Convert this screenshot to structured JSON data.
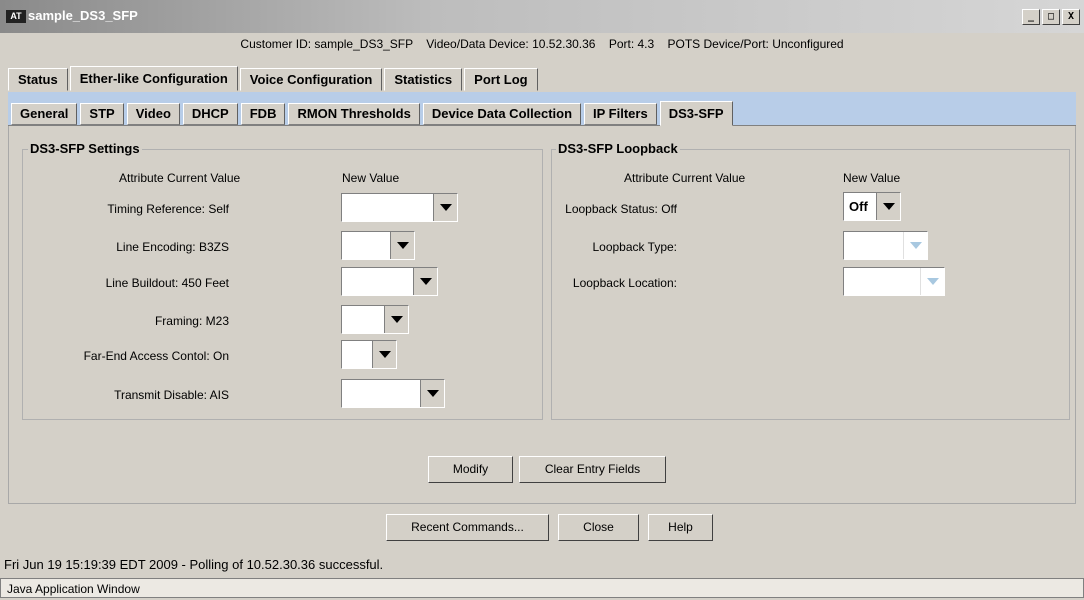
{
  "window": {
    "title": "sample_DS3_SFP",
    "app_icon": "app-logo-icon",
    "controls": {
      "minimize": "_",
      "maximize": "□",
      "close": "X"
    }
  },
  "info": {
    "text": "Customer ID: sample_DS3_SFP    Video/Data Device: 10.52.30.36    Port: 4.3    POTS Device/Port: Unconfigured"
  },
  "main_tabs": [
    {
      "label": "Status"
    },
    {
      "label": "Ether-like Configuration",
      "selected": true
    },
    {
      "label": "Voice Configuration"
    },
    {
      "label": "Statistics"
    },
    {
      "label": "Port Log"
    }
  ],
  "sub_tabs": [
    {
      "label": "General"
    },
    {
      "label": "STP"
    },
    {
      "label": "Video"
    },
    {
      "label": "DHCP"
    },
    {
      "label": "FDB"
    },
    {
      "label": "RMON Thresholds"
    },
    {
      "label": "Device Data Collection"
    },
    {
      "label": "IP Filters"
    },
    {
      "label": "DS3-SFP",
      "selected": true
    }
  ],
  "settings": {
    "title": "DS3-SFP Settings",
    "header_attr": "Attribute Current Value",
    "header_new": "New Value",
    "rows": [
      {
        "label": "Timing Reference: Self",
        "new_value": ""
      },
      {
        "label": "Line Encoding: B3ZS",
        "new_value": ""
      },
      {
        "label": "Line Buildout: 450 Feet",
        "new_value": ""
      },
      {
        "label": "Framing: M23",
        "new_value": ""
      },
      {
        "label": "Far-End Access Contol: On",
        "new_value": ""
      },
      {
        "label": "Transmit Disable: AIS",
        "new_value": ""
      }
    ]
  },
  "loopback": {
    "title": "DS3-SFP Loopback",
    "header_attr": "Attribute Current Value",
    "header_new": "New Value",
    "rows": [
      {
        "label": "Loopback Status: Off",
        "new_value": "Off"
      },
      {
        "label": "Loopback Type:",
        "new_value": ""
      },
      {
        "label": "Loopback Location:",
        "new_value": ""
      }
    ]
  },
  "buttons": {
    "modify": "Modify",
    "clear": "Clear Entry Fields",
    "recent": "Recent Commands...",
    "close": "Close",
    "help": "Help"
  },
  "status": {
    "message": "Fri Jun 19 15:19:39 EDT 2009 - Polling of 10.52.30.36 successful.",
    "window_label": "Java Application Window"
  }
}
